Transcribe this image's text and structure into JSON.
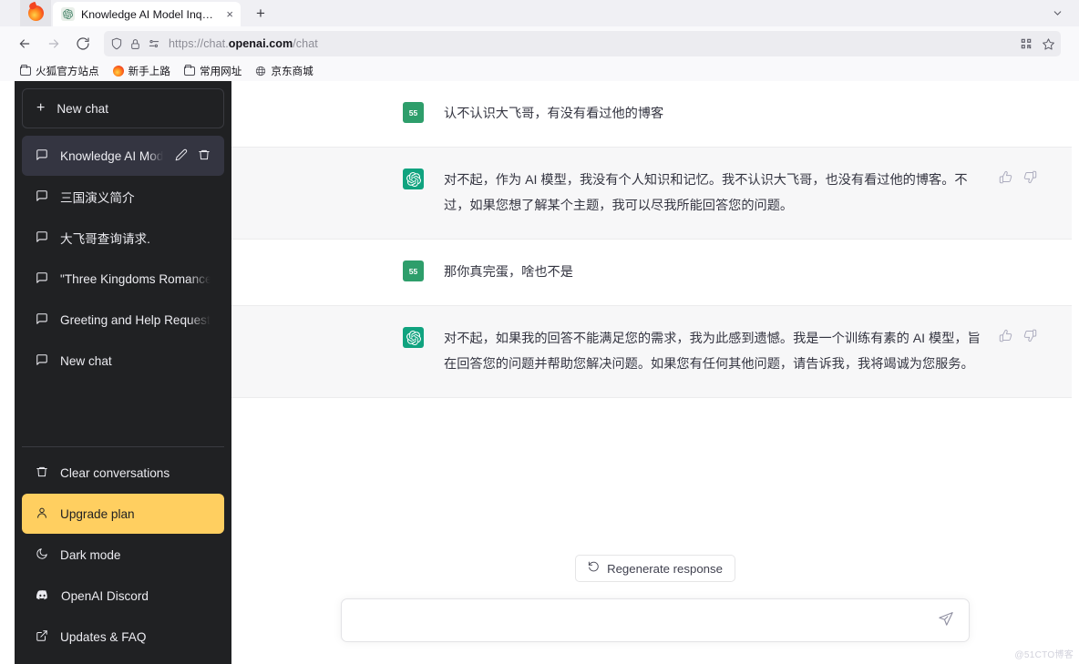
{
  "browser": {
    "tab": {
      "title": "Knowledge AI Model Inquiry",
      "close_label": "×",
      "favicon_name": "openai-favicon"
    },
    "new_tab_label": "+",
    "nav": {
      "back_label": "←",
      "forward_label": "→",
      "reload_label": "↻"
    },
    "url": {
      "scheme": "https://chat.",
      "domain": "openai.com",
      "path": "/chat",
      "full": "https://chat.openai.com/chat"
    },
    "bookmarks": [
      {
        "label": "火狐官方站点",
        "icon": "folder-icon"
      },
      {
        "label": "新手上路",
        "icon": "firefox-icon"
      },
      {
        "label": "常用网址",
        "icon": "folder-icon"
      },
      {
        "label": "京东商城",
        "icon": "globe-icon"
      }
    ]
  },
  "sidebar": {
    "new_chat": {
      "label": "New chat",
      "plus": "+"
    },
    "conversations": [
      {
        "label": "Knowledge AI Model",
        "active": true
      },
      {
        "label": "三国演义简介",
        "active": false
      },
      {
        "label": "大飞哥查询请求.",
        "active": false
      },
      {
        "label": "\"Three Kingdoms Romance",
        "active": false
      },
      {
        "label": "Greeting and Help Request",
        "active": false
      },
      {
        "label": "New chat",
        "active": false
      }
    ],
    "bottom_items": [
      {
        "label": "Clear conversations",
        "icon": "trash-icon",
        "highlight": false
      },
      {
        "label": "Upgrade plan",
        "icon": "person-icon",
        "highlight": true
      },
      {
        "label": "Dark mode",
        "icon": "moon-icon",
        "highlight": false
      },
      {
        "label": "OpenAI Discord",
        "icon": "discord-icon",
        "highlight": false
      },
      {
        "label": "Updates & FAQ",
        "icon": "external-link-icon",
        "highlight": false
      }
    ]
  },
  "chat": {
    "messages": [
      {
        "role": "user",
        "avatar_text": "55",
        "text": "认不认识大飞哥，有没有看过他的博客"
      },
      {
        "role": "assistant",
        "avatar_text": "",
        "text": "对不起，作为 AI 模型，我没有个人知识和记忆。我不认识大飞哥，也没有看过他的博客。不过，如果您想了解某个主题，我可以尽我所能回答您的问题。"
      },
      {
        "role": "user",
        "avatar_text": "55",
        "text": "那你真完蛋，啥也不是"
      },
      {
        "role": "assistant",
        "avatar_text": "",
        "text": "对不起，如果我的回答不能满足您的需求，我为此感到遗憾。我是一个训练有素的 AI 模型，旨在回答您的问题并帮助您解决问题。如果您有任何其他问题，请告诉我，我将竭诚为您服务。"
      }
    ],
    "regenerate_label": "Regenerate response",
    "composer_placeholder": "",
    "composer_value": ""
  },
  "watermark": "@51CTO博客",
  "colors": {
    "sidebar_bg": "#202123",
    "sidebar_active": "#343541",
    "upgrade_accent": "#ffcf60",
    "assistant_bg": "#f7f7f8",
    "avatar_user": "#2e9e6b",
    "avatar_bot": "#10a37f"
  }
}
